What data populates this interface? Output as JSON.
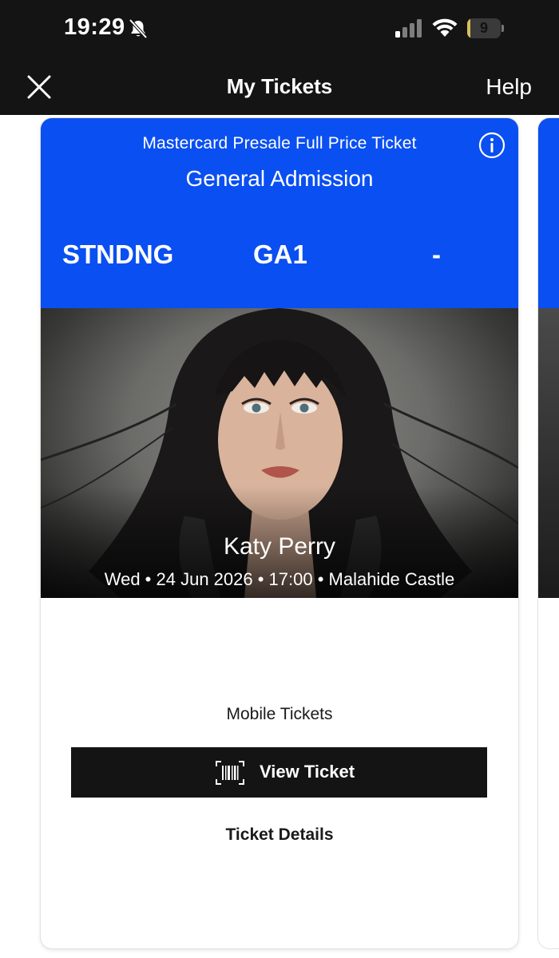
{
  "status_bar": {
    "time": "19:29",
    "battery_level": "9",
    "battery_fraction": 0.09,
    "icons": [
      "bell-off-icon",
      "signal-icon",
      "wifi-icon",
      "battery-icon"
    ]
  },
  "nav": {
    "title": "My Tickets",
    "help_label": "Help",
    "close_icon": "close-icon"
  },
  "ticket": {
    "type": "Mastercard Presale Full Price Ticket",
    "admission": "General Admission",
    "section": "STNDNG",
    "row": "GA1",
    "seat": "-",
    "artist": "Katy Perry",
    "event_meta": "Wed • 24 Jun 2026 • 17:00 • Malahide Castle",
    "mobile_tickets_label": "Mobile Tickets",
    "view_ticket_label": "View Ticket",
    "ticket_details_label": "Ticket Details"
  },
  "colors": {
    "header_blue": "#0a4ff1",
    "dark": "#141414",
    "battery_accent": "#d8c05a"
  }
}
